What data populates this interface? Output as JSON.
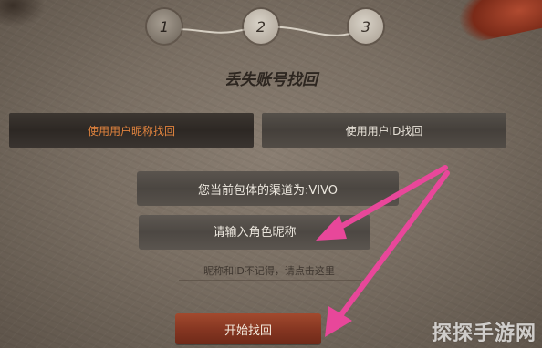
{
  "steps": [
    "1",
    "2",
    "3"
  ],
  "title": "丢失账号找回",
  "tabs": {
    "by_nickname": "使用用户昵称找回",
    "by_id": "使用用户ID找回"
  },
  "channel_text": "您当前包体的渠道为:VIVO",
  "nickname_input": {
    "value": "",
    "placeholder": "请输入角色昵称"
  },
  "forgot_link": "昵称和ID不记得，请点击这里",
  "start_button": "开始找回",
  "watermark": "探探手游网",
  "colors": {
    "active_tab_text": "#e0833e",
    "start_button": "#8e3a24",
    "annotation_arrow": "#e8479a"
  }
}
